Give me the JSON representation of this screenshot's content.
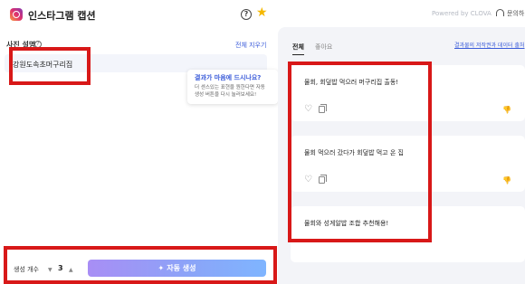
{
  "header": {
    "title": "인스타그램 캡션",
    "help_glyph": "?",
    "star_glyph": "★",
    "powered_by": "Powered by CLOVA",
    "inquiry": "문의하기"
  },
  "left": {
    "photo_label": "사진 설명",
    "info_glyph": "?",
    "clear_all": "전체 지우기",
    "input_value": "강원도속초머구리집",
    "tooltip": {
      "title": "결과가 마음에 드시나요?",
      "line1": "더 센스있는 표현을 원한다면 자동",
      "line2": "생성 버튼을 다시 눌러보세요!"
    }
  },
  "bottom": {
    "count_label": "생성 개수",
    "count_down": "▼",
    "count_value": "3",
    "count_up": "▲",
    "wand": "✦",
    "generate_label": "자동 생성"
  },
  "right": {
    "tabs": [
      "전체",
      "좋아요"
    ],
    "report_link": "결과물의 저작권과 데이터 출처",
    "cards": [
      {
        "text": "물회, 회덮밥 먹으러 머구리집 출동!"
      },
      {
        "text": "물회 먹으러 갔다가 회덮밥 먹고 온 집"
      },
      {
        "text": "물회와 성게알밥 조합 추천해용!"
      }
    ],
    "heart_glyph": "♡",
    "thumb_glyph": "👎"
  },
  "colors": {
    "accent_blue": "#3a5bd9",
    "annotation_red": "#d81818",
    "button_gradient_start": "#a88ef5",
    "button_gradient_end": "#7fb5ff",
    "star": "#f5b800"
  }
}
